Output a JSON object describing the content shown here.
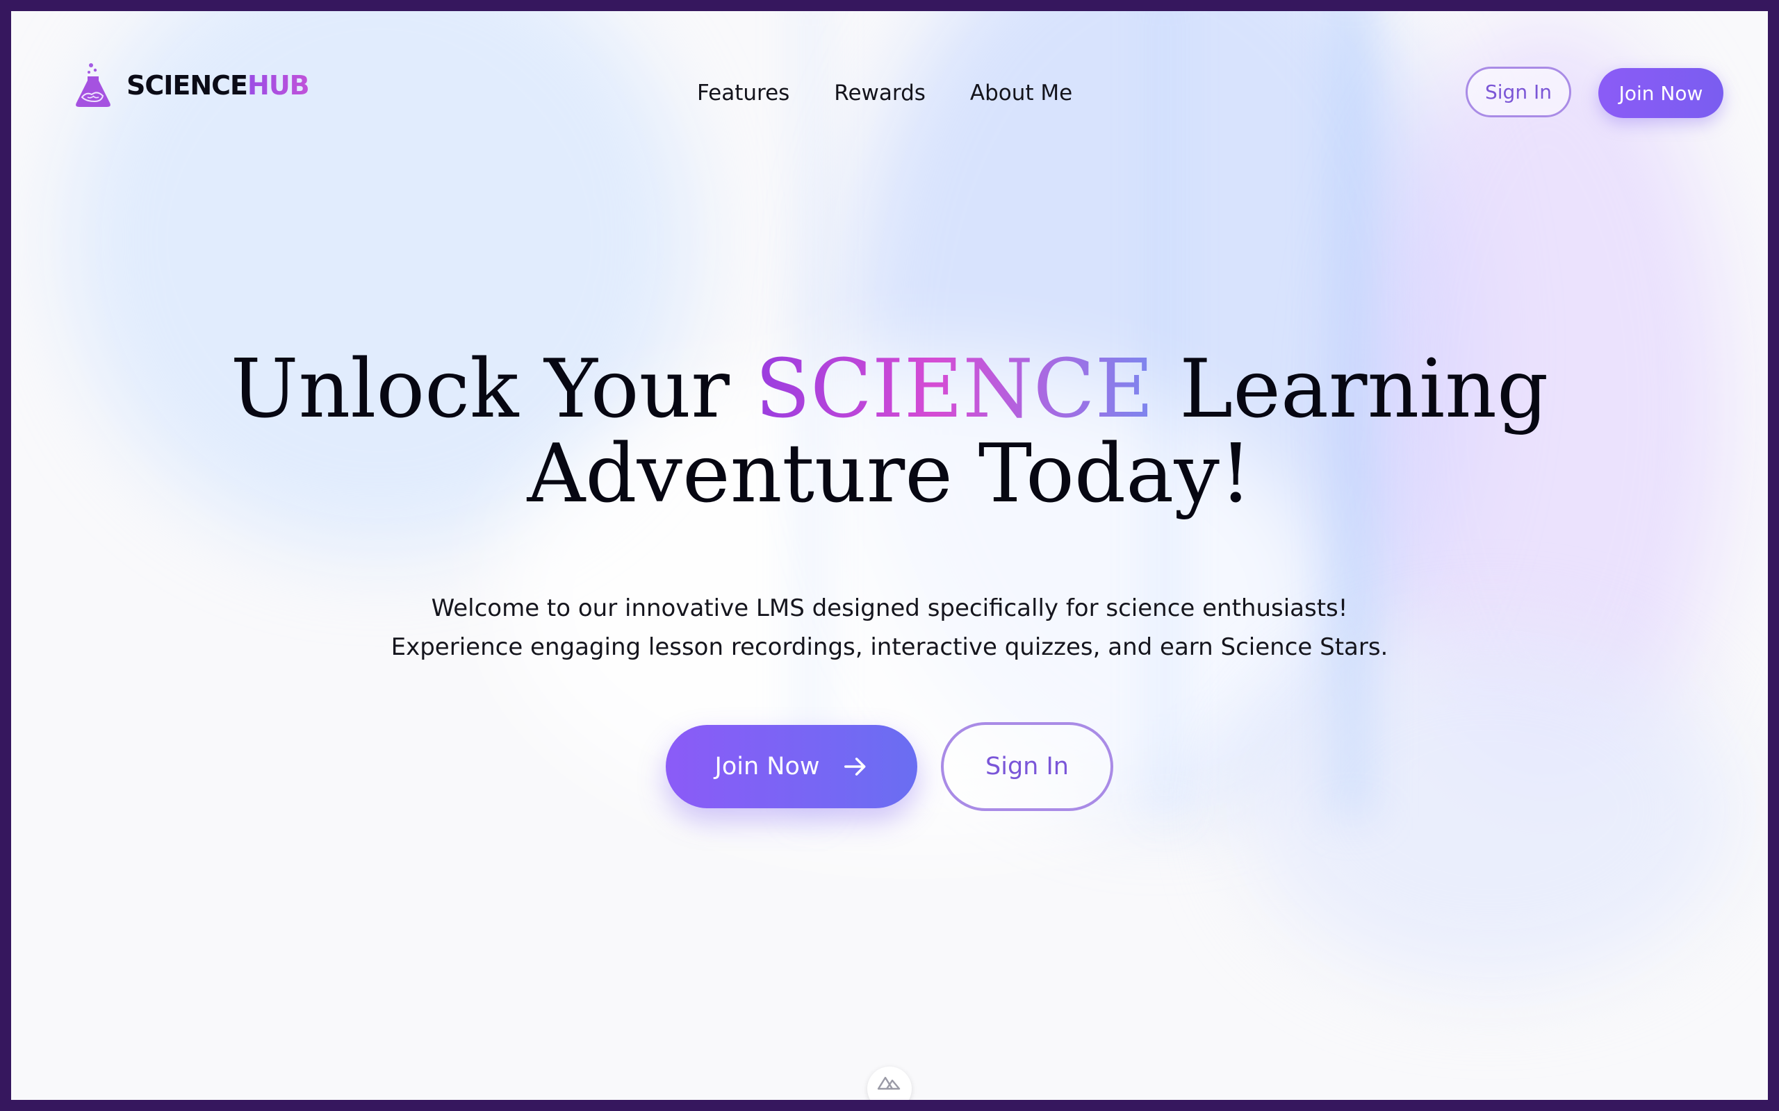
{
  "brand": {
    "name_part1": "SCIENCE",
    "name_part2": "HUB",
    "icon": "flask-icon"
  },
  "nav": {
    "items": [
      {
        "label": "Features"
      },
      {
        "label": "Rewards"
      },
      {
        "label": "About Me"
      }
    ]
  },
  "header": {
    "signin_label": "Sign In",
    "join_label": "Join Now"
  },
  "hero": {
    "title_before": "Unlock Your ",
    "title_accent": "SCIENCE",
    "title_after": " Learning",
    "title_line2": "Adventure Today!",
    "subtitle_line1": "Welcome to our innovative LMS designed specifically for science enthusiasts!",
    "subtitle_line2": "Experience engaging lesson recordings, interactive quizzes, and earn Science Stars.",
    "join_label": "Join Now",
    "join_icon": "arrow-right-icon",
    "signin_label": "Sign In"
  },
  "footer_badge": {
    "icon": "nuxt-logo-icon"
  },
  "colors": {
    "accent": "#8b5cf6",
    "accent_border": "#a98be6",
    "frame": "#36175e",
    "text": "#0b0b16"
  }
}
